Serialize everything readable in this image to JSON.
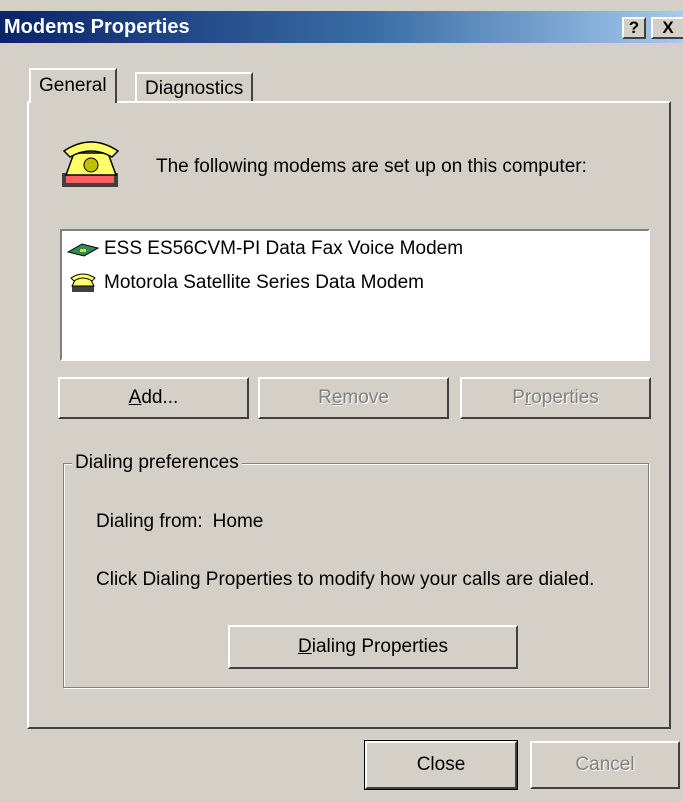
{
  "window": {
    "title": "Modems Properties",
    "help_button": "?",
    "close_button": "X"
  },
  "tabs": [
    {
      "label": "General",
      "active": true
    },
    {
      "label": "Diagnostics",
      "active": false
    }
  ],
  "general": {
    "intro_text": "The following modems are set up on this computer:",
    "modems": [
      {
        "name": "ESS ES56CVM-PI Data Fax Voice Modem",
        "icon": "modem-card-icon"
      },
      {
        "name": "Motorola Satellite Series Data Modem",
        "icon": "phone-modem-icon"
      }
    ],
    "buttons": {
      "add_pre": "",
      "add_key": "A",
      "add_post": "dd...",
      "remove_pre": "R",
      "remove_key": "e",
      "remove_post": "move",
      "properties_pre": "P",
      "properties_key": "r",
      "properties_post": "operties"
    },
    "dialing_preferences": {
      "legend": "Dialing preferences",
      "from_label": "Dialing from:",
      "from_value": "Home",
      "info": "Click Dialing Properties to modify how your calls are dialed.",
      "button_key": "D",
      "button_rest": "ialing Properties"
    }
  },
  "footer": {
    "close_label": "Close",
    "cancel_label": "Cancel"
  },
  "colors": {
    "titlebar_start": "#0a246a",
    "titlebar_end": "#a6caf0",
    "face": "#d4d0c8"
  }
}
